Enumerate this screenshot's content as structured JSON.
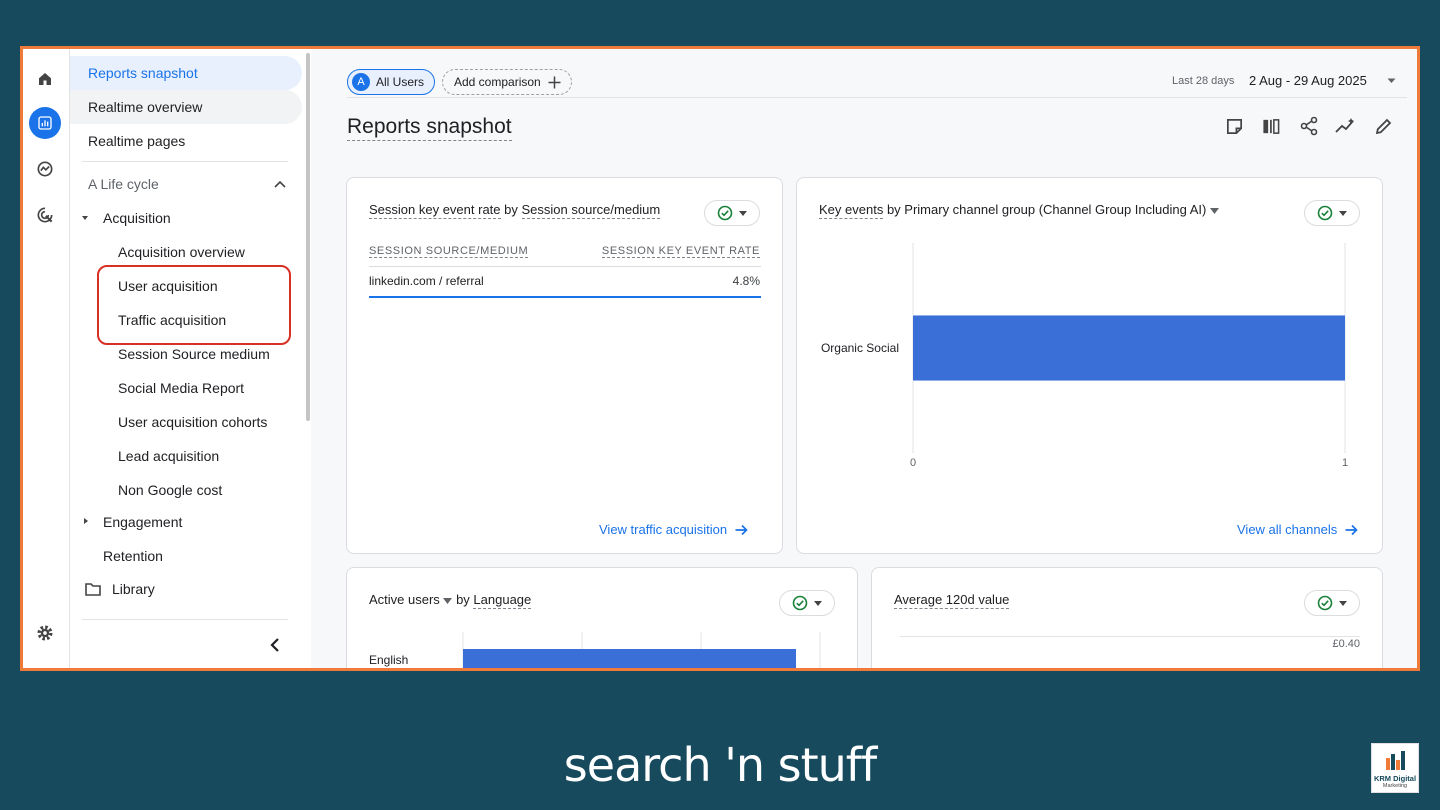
{
  "nav": {
    "items_top": [
      "Reports snapshot",
      "Realtime overview",
      "Realtime pages"
    ],
    "section": "A Life cycle",
    "acquisition": "Acquisition",
    "acquisition_children": [
      "Acquisition overview",
      "User acquisition",
      "Traffic acquisition",
      "Session Source medium",
      "Social Media Report",
      "User acquisition cohorts",
      "Lead acquisition",
      "Non Google cost"
    ],
    "engagement": "Engagement",
    "retention": "Retention",
    "library": "Library"
  },
  "header": {
    "segment_letter": "A",
    "segment": "All Users",
    "add_comparison": "Add comparison",
    "range_label": "Last 28 days",
    "date_range": "2 Aug - 29 Aug 2025",
    "page_title": "Reports snapshot"
  },
  "card1": {
    "title_metric": "Session key event rate",
    "title_by": "by",
    "title_dim": "Session source/medium",
    "col1": "SESSION SOURCE/MEDIUM",
    "col2": "SESSION KEY EVENT RATE",
    "row_source": "linkedin.com / referral",
    "row_value": "4.8%",
    "link": "View traffic acquisition"
  },
  "card2": {
    "title_metric": "Key events",
    "title_rest": "by Primary channel group (Channel Group Including AI)",
    "link": "View all channels"
  },
  "card3": {
    "title_metric": "Active users",
    "title_by": "by",
    "title_dim": "Language"
  },
  "card4": {
    "title": "Average 120d value",
    "axis_value": "£0.40"
  },
  "chart_data": [
    {
      "type": "bar",
      "orientation": "horizontal",
      "categories": [
        "Organic Social"
      ],
      "values": [
        1
      ],
      "xlim": [
        0,
        1
      ],
      "x_ticks": [
        "0",
        "1"
      ]
    },
    {
      "type": "bar",
      "orientation": "horizontal",
      "categories": [
        "English"
      ],
      "values": [
        1
      ]
    }
  ],
  "brand": "search 'n stuff",
  "logo_text": "KRM Digital",
  "logo_sub": "Marketing",
  "colors": {
    "accent": "#1a73e8",
    "bar": "#3a6fd8",
    "frame": "#f07a3a",
    "highlight": "#d93025",
    "background": "#174a5c"
  }
}
